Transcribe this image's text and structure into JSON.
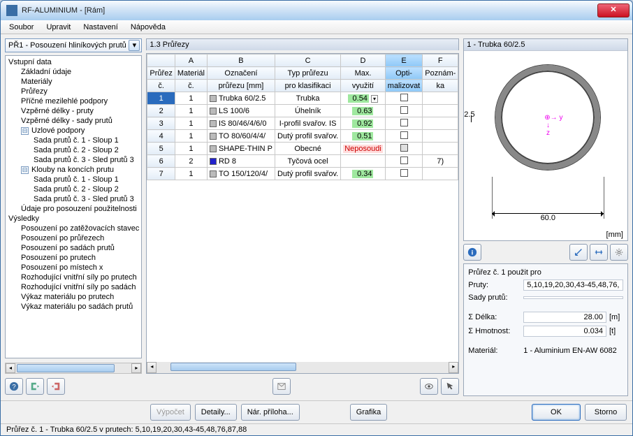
{
  "window": {
    "title": "RF-ALUMINIUM - [Rám]"
  },
  "menu": {
    "items": [
      "Soubor",
      "Upravit",
      "Nastavení",
      "Nápověda"
    ]
  },
  "caseCombo": "PŘ1 - Posouzení hliníkových prutů",
  "tree": [
    {
      "l": 1,
      "t": "Vstupní data"
    },
    {
      "l": 2,
      "t": "Základní údaje"
    },
    {
      "l": 2,
      "t": "Materiály"
    },
    {
      "l": 2,
      "t": "Průřezy"
    },
    {
      "l": 2,
      "t": "Příčné mezilehlé podpory"
    },
    {
      "l": 2,
      "t": "Vzpěrné délky - pruty"
    },
    {
      "l": 2,
      "t": "Vzpěrné délky - sady prutů"
    },
    {
      "l": 2,
      "t": "Uzlové podpory",
      "exp": true
    },
    {
      "l": 3,
      "t": "Sada prutů č. 1 - Sloup 1"
    },
    {
      "l": 3,
      "t": "Sada prutů č. 2 - Sloup 2"
    },
    {
      "l": 3,
      "t": "Sada prutů č. 3 - Sled prutů 3"
    },
    {
      "l": 2,
      "t": "Klouby na koncích prutu",
      "exp": true
    },
    {
      "l": 3,
      "t": "Sada prutů č. 1 - Sloup 1"
    },
    {
      "l": 3,
      "t": "Sada prutů č. 2 - Sloup 2"
    },
    {
      "l": 3,
      "t": "Sada prutů č. 3 - Sled prutů 3"
    },
    {
      "l": 2,
      "t": "Údaje pro posouzení použitelnosti"
    },
    {
      "l": 1,
      "t": "Výsledky"
    },
    {
      "l": 2,
      "t": "Posouzení po zatěžovacích stavec"
    },
    {
      "l": 2,
      "t": "Posouzení po průřezech"
    },
    {
      "l": 2,
      "t": "Posouzení po sadách prutů"
    },
    {
      "l": 2,
      "t": "Posouzení po prutech"
    },
    {
      "l": 2,
      "t": "Posouzení po místech x"
    },
    {
      "l": 2,
      "t": "Rozhodující vnitřní síly po prutech"
    },
    {
      "l": 2,
      "t": "Rozhodující vnitřní síly po sadách"
    },
    {
      "l": 2,
      "t": "Výkaz materiálu po prutech"
    },
    {
      "l": 2,
      "t": "Výkaz materiálu po sadách prutů"
    }
  ],
  "table": {
    "title": "1.3 Průřezy",
    "cols": [
      "A",
      "B",
      "C",
      "D",
      "E",
      "F"
    ],
    "hdr1": [
      "Průřez",
      "Materiál",
      "Označení",
      "Typ průřezu",
      "Max.",
      "Opti-",
      "Poznám-"
    ],
    "hdr2": [
      "č.",
      "č.",
      "průřezu [mm]",
      "pro klasifikaci",
      "využití",
      "malizovat",
      "ka"
    ],
    "rows": [
      {
        "n": "1",
        "mat": "1",
        "sw": "#bbb",
        "name": "Trubka 60/2.5",
        "type": "Trubka",
        "util": "0.54",
        "opt": true,
        "note": "",
        "sel": true
      },
      {
        "n": "2",
        "mat": "1",
        "sw": "#bbb",
        "name": "LS 100/6",
        "type": "Úhelník",
        "util": "0.63",
        "opt": true,
        "note": ""
      },
      {
        "n": "3",
        "mat": "1",
        "sw": "#bbb",
        "name": "IS 80/46/4/6/0",
        "type": "I-profil svařov. IS",
        "util": "0.92",
        "opt": true,
        "note": ""
      },
      {
        "n": "4",
        "mat": "1",
        "sw": "#bbb",
        "name": "TO 80/60/4/4/",
        "type": "Dutý profil svařov.",
        "util": "0.51",
        "opt": true,
        "note": ""
      },
      {
        "n": "5",
        "mat": "1",
        "sw": "#bbb",
        "name": "SHAPE-THIN P",
        "type": "Obecné",
        "util": "Neposoudi",
        "red": true,
        "optdis": true,
        "note": ""
      },
      {
        "n": "6",
        "mat": "2",
        "sw": "#22c",
        "name": "RD 8",
        "type": "Tyčová ocel",
        "util": "",
        "opt": true,
        "note": "7)"
      },
      {
        "n": "7",
        "mat": "1",
        "sw": "#bbb",
        "name": "TO 150/120/4/",
        "type": "Dutý profil svařov.",
        "util": "0.34",
        "opt": true,
        "note": ""
      }
    ]
  },
  "preview": {
    "title": "1 - Trubka 60/2.5",
    "dimW": "60.0",
    "dimT": "2.5",
    "unit": "[mm]"
  },
  "info": {
    "heading": "Průřez č. 1 použit pro",
    "prutyLbl": "Pruty:",
    "prutyVal": "5,10,19,20,30,43-45,48,76,",
    "sadyLbl": "Sady prutů:",
    "sadyVal": "",
    "lenLbl": "Σ Délka:",
    "lenVal": "28.00",
    "lenUnit": "[m]",
    "massLbl": "Σ Hmotnost:",
    "massVal": "0.034",
    "massUnit": "[t]",
    "matLbl": "Materiál:",
    "matVal": "1 - Aluminium EN-AW 6082"
  },
  "buttons": {
    "vypocet": "Výpočet",
    "detaily": "Detaily...",
    "narpriloha": "Nár. příloha...",
    "grafika": "Grafika",
    "ok": "OK",
    "storno": "Storno"
  },
  "status": "Průřez č. 1 - Trubka 60/2.5 v prutech: 5,10,19,20,30,43-45,48,76,87,88"
}
